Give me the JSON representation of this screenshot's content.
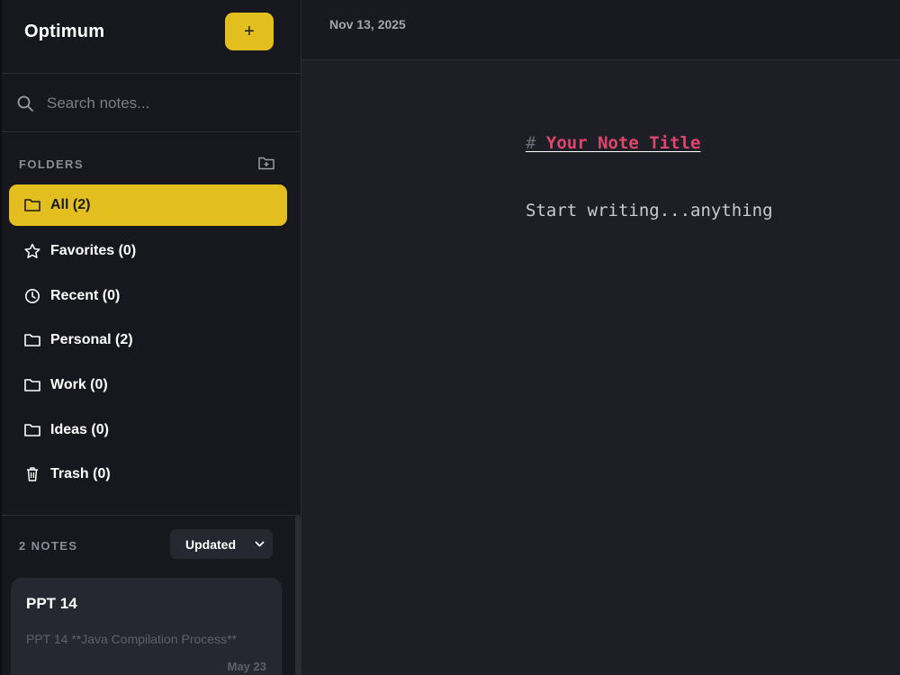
{
  "app": {
    "title": "Optimum",
    "new_label": "+"
  },
  "search": {
    "placeholder": "Search notes..."
  },
  "folders": {
    "label": "FOLDERS",
    "items": [
      {
        "label": "All (2)",
        "icon": "folder-icon",
        "active": true
      },
      {
        "label": "Favorites (0)",
        "icon": "star-icon"
      },
      {
        "label": "Recent (0)",
        "icon": "clock-icon"
      },
      {
        "label": "Personal (2)",
        "icon": "folder-icon"
      },
      {
        "label": "Work (0)",
        "icon": "folder-icon"
      },
      {
        "label": "Ideas (0)",
        "icon": "folder-icon"
      },
      {
        "label": "Trash (0)",
        "icon": "trash-icon"
      }
    ]
  },
  "notes": {
    "count_label": "2 NOTES",
    "sort_value": "Updated",
    "cards": [
      {
        "title": "PPT 14",
        "preview": "PPT 14 **Java Compilation Process**",
        "date": "May 23"
      }
    ]
  },
  "editor": {
    "date": "Nov 13, 2025",
    "heading_hash": "#",
    "heading_title": " Your Note Title",
    "body": "Start writing...anything"
  },
  "colors": {
    "accent": "#e2bf1f",
    "heading": "#e0466c",
    "sidebar_bg": "#17171e",
    "main_bg": "#1e1f26"
  }
}
